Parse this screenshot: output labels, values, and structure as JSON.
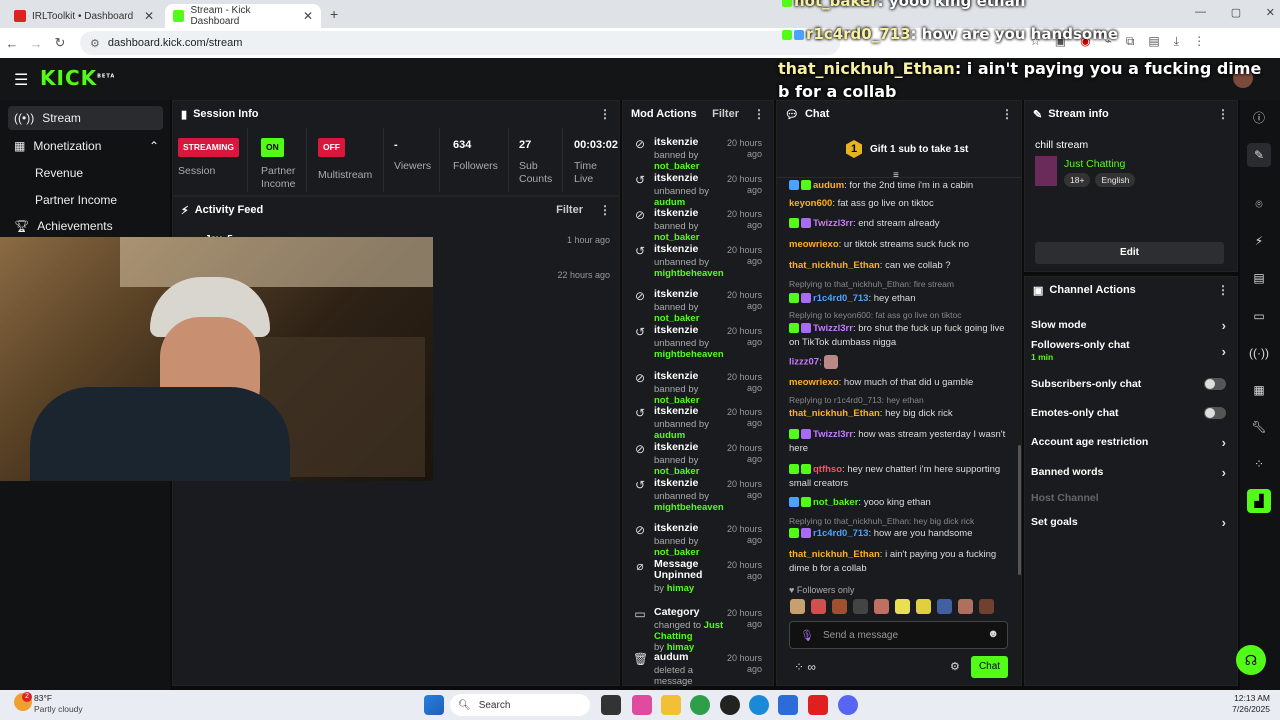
{
  "browser": {
    "tabs": [
      {
        "label": "IRLToolkit • Dashboard"
      },
      {
        "label": "Stream - Kick Dashboard"
      }
    ],
    "new_tab": "+",
    "url": "dashboard.kick.com/stream"
  },
  "brand": {
    "logo": "KICK",
    "beta": "BETA",
    "accent": "#53fc18"
  },
  "overlay": [
    {
      "user": "not_baker",
      "text": "yooo king ethan"
    },
    {
      "user": "r1c4rd0_713",
      "text": "how are you handsome"
    },
    {
      "user": "that_nickhuh_Ethan",
      "text": "i ain't paying you a fucking dime b for a collab"
    }
  ],
  "sidebar": {
    "items": [
      {
        "label": "Stream"
      },
      {
        "label": "Monetization"
      },
      {
        "label": "Revenue"
      },
      {
        "label": "Partner Income"
      },
      {
        "label": "Achievements"
      }
    ]
  },
  "session": {
    "title": "Session Info",
    "cells": [
      {
        "badge": "STREAMING",
        "label": "Session"
      },
      {
        "badge": "ON",
        "label": "Partner Income"
      },
      {
        "badge": "OFF",
        "label": "Multistream"
      },
      {
        "value": "-",
        "label": "Viewers"
      },
      {
        "value": "634",
        "label": "Followers"
      },
      {
        "value": "27",
        "label": "Sub Counts"
      },
      {
        "value": "00:03:02",
        "label": "Time Live"
      }
    ]
  },
  "activity": {
    "title": "Activity Feed",
    "filter": "Filter",
    "items": [
      {
        "user": "Jay_5",
        "time": "1 hour ago"
      },
      {
        "time": "22 hours ago"
      }
    ]
  },
  "mod": {
    "title": "Mod Actions",
    "filter": "Filter",
    "items": [
      {
        "name": "itskenzie",
        "time": "20 hours ago",
        "action": "banned by",
        "by": "not_baker",
        "icon": "ban"
      },
      {
        "name": "itskenzie",
        "time": "20 hours ago",
        "action": "unbanned by",
        "by": "audum",
        "icon": "undo"
      },
      {
        "name": "itskenzie",
        "time": "20 hours ago",
        "action": "banned by",
        "by": "not_baker",
        "icon": "ban"
      },
      {
        "name": "itskenzie",
        "time": "20 hours ago",
        "action": "unbanned by",
        "by": "mightbeheaven",
        "icon": "undo"
      },
      {
        "name": "itskenzie",
        "time": "20 hours ago",
        "action": "banned by",
        "by": "not_baker",
        "icon": "ban"
      },
      {
        "name": "itskenzie",
        "time": "20 hours ago",
        "action": "unbanned by",
        "by": "mightbeheaven",
        "icon": "undo"
      },
      {
        "name": "itskenzie",
        "time": "20 hours ago",
        "action": "banned by",
        "by": "not_baker",
        "icon": "ban"
      },
      {
        "name": "itskenzie",
        "time": "20 hours ago",
        "action": "unbanned by",
        "by": "audum",
        "icon": "undo"
      },
      {
        "name": "itskenzie",
        "time": "20 hours ago",
        "action": "banned by",
        "by": "not_baker",
        "icon": "ban"
      },
      {
        "name": "itskenzie",
        "time": "20 hours ago",
        "action": "unbanned by",
        "by": "mightbeheaven",
        "icon": "undo"
      },
      {
        "name": "itskenzie",
        "time": "20 hours ago",
        "action": "banned by",
        "by": "not_baker",
        "icon": "ban"
      },
      {
        "name": "Message Unpinned",
        "time": "20 hours ago",
        "action": "by",
        "by": "himay",
        "icon": "unpin"
      },
      {
        "name": "Category",
        "time": "20 hours ago",
        "action": "changed to",
        "by": "Just Chatting",
        "action2": "by",
        "by2": "himay",
        "icon": "category"
      },
      {
        "name": "audum",
        "time": "20 hours ago",
        "action": "deleted a message",
        "by": "",
        "icon": "trash"
      }
    ]
  },
  "chat": {
    "title": "Chat",
    "gift": "Gift 1 sub to take 1st",
    "gift_count": "1",
    "messages": [
      {
        "user": "audum",
        "text": "for the 2nd time i'm in a cabin",
        "color": "#ffb020"
      },
      {
        "user": "keyon600",
        "text": "fat ass go live on tiktoc",
        "color": "#ffb020"
      },
      {
        "user": "Twizzl3rr",
        "text": "end stream already",
        "color": "#c47bff"
      },
      {
        "user": "meowriexo",
        "text": "ur tiktok streams suck fuck no",
        "color": "#ffb020"
      },
      {
        "user": "that_nickhuh_Ethan",
        "text": "can we collab ?",
        "color": "#ffb020"
      },
      {
        "reply": "Replying to that_nickhuh_Ethan: fire stream",
        "user": "r1c4rd0_713",
        "text": "hey ethan",
        "color": "#4aa3ff"
      },
      {
        "reply": "Replying to keyon600: fat ass go live on tiktoc",
        "user": "Twizzl3rr",
        "text": "bro shut the fuck up fuck going live on TikTok dumbass nigga",
        "color": "#c47bff"
      },
      {
        "user": "lizzz07",
        "text": "",
        "color": "#c47bff"
      },
      {
        "user": "meowriexo",
        "text": "how much of that did u gamble",
        "color": "#ffb020"
      },
      {
        "reply": "Replying to r1c4rd0_713: hey ethan",
        "user": "that_nickhuh_Ethan",
        "text": "hey big dick rick",
        "color": "#ffb020"
      },
      {
        "user": "Twizzl3rr",
        "text": "how was stream yesterday I wasn't here",
        "color": "#c47bff"
      },
      {
        "user": "qtfhso",
        "text": "hey new chatter! i'm here supporting small creators",
        "color": "#ff4d6a"
      },
      {
        "user": "not_baker",
        "text": "yooo king ethan",
        "color": "#53fc18"
      },
      {
        "reply": "Replying to that_nickhuh_Ethan: hey big dick rick",
        "user": "r1c4rd0_713",
        "text": "how are you handsome",
        "color": "#4aa3ff"
      },
      {
        "user": "that_nickhuh_Ethan",
        "text": "i ain't paying you a fucking dime b for a collab",
        "color": "#ffb020"
      }
    ],
    "followers_only": "Followers only",
    "placeholder": "Send a message",
    "send": "Chat"
  },
  "stream_info": {
    "title": "Stream info",
    "stream_title": "chill stream",
    "category": "Just Chatting",
    "tags": [
      "18+",
      "English"
    ],
    "edit": "Edit"
  },
  "channel_actions": {
    "title": "Channel Actions",
    "items": [
      {
        "label": "Slow mode",
        "type": "chevron"
      },
      {
        "label": "Followers-only chat",
        "sub": "1 min",
        "type": "chevron"
      },
      {
        "label": "Subscribers-only chat",
        "type": "toggle"
      },
      {
        "label": "Emotes-only chat",
        "type": "toggle"
      },
      {
        "label": "Account age restriction",
        "type": "chevron"
      },
      {
        "label": "Banned words",
        "type": "chevron"
      },
      {
        "label": "Host Channel",
        "type": "disabled"
      },
      {
        "label": "Set goals",
        "type": "chevron"
      }
    ]
  },
  "taskbar": {
    "weather_temp": "83°F",
    "weather_desc": "Partly cloudy",
    "weather_badge": "2",
    "search": "Search",
    "time": "12:13 AM",
    "date": "7/26/2025"
  }
}
